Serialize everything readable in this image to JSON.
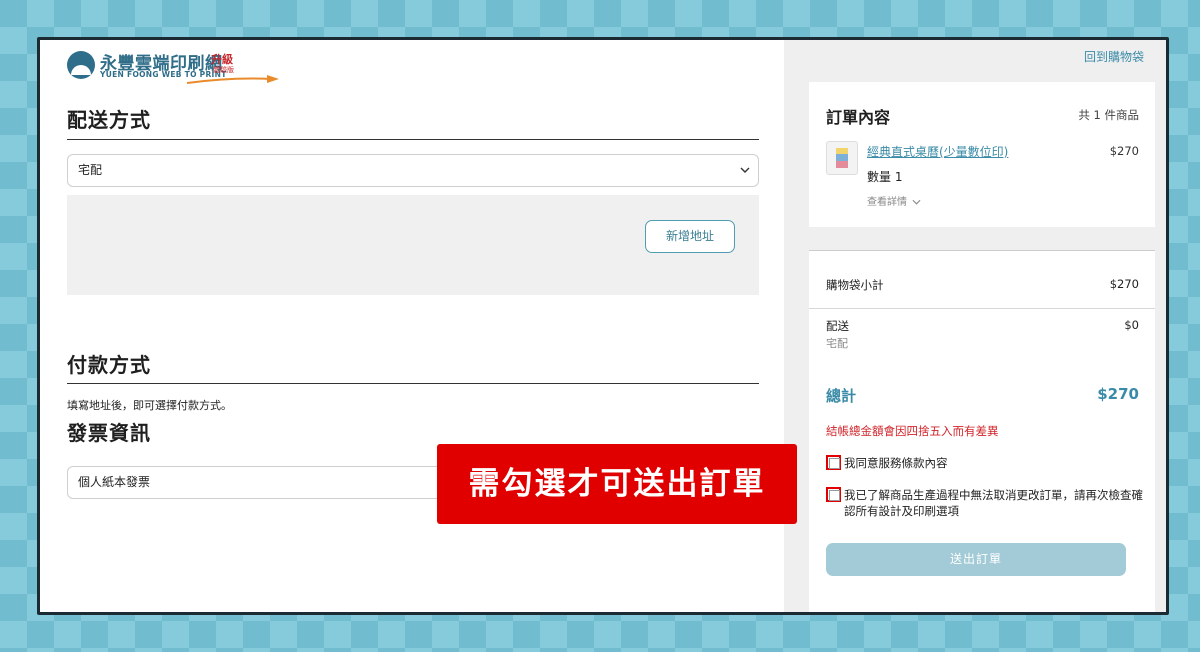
{
  "logo": {
    "name_cn": "永豐雲端印刷網",
    "name_en": "YUEN FOONG WEB TO PRINT",
    "upgrade": "升級",
    "edition": "體驗版"
  },
  "shipping": {
    "heading": "配送方式",
    "method": "宅配",
    "add_address_label": "新增地址"
  },
  "payment": {
    "heading": "付款方式",
    "note": "填寫地址後，即可選擇付款方式。"
  },
  "invoice": {
    "heading": "發票資訊",
    "type": "個人紙本發票"
  },
  "sidebar": {
    "back_link": "回到購物袋",
    "order_title": "訂單內容",
    "item_count": "共 1 件商品",
    "product": {
      "name": "經典直式桌曆(少量數位印)",
      "price": "$270",
      "qty": "數量 1",
      "details_label": "查看詳情"
    },
    "subtotal_label": "購物袋小計",
    "subtotal_value": "$270",
    "shipping_label": "配送",
    "shipping_value": "$0",
    "shipping_method": "宅配",
    "total_label": "總計",
    "total_value": "$270",
    "rounding_warning": "結帳總金額會因四捨五入而有差異",
    "agree_terms": "我同意服務條款內容",
    "agree_production": "我已了解商品生產過程中無法取消更改訂單，請再次檢查確認所有設計及印刷選項",
    "submit_label": "送出訂單"
  },
  "callout": {
    "text": "需勾選才可送出訂單",
    "color": "#e00000"
  },
  "colors": {
    "accent": "#3a8ba7",
    "warning": "#d0242a",
    "background": "#7cc4d6"
  }
}
